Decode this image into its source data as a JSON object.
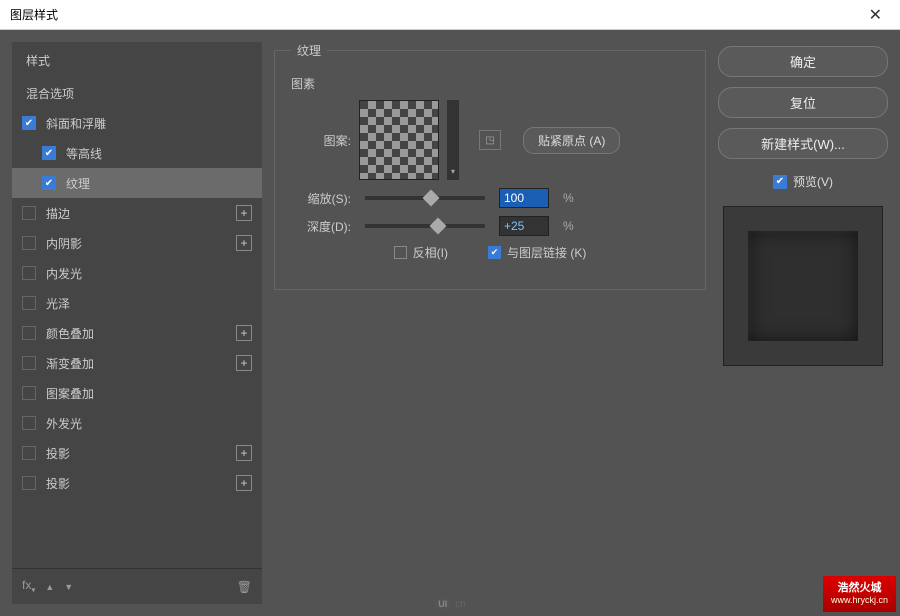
{
  "titlebar": {
    "title": "图层样式",
    "close": "✕"
  },
  "left": {
    "header_styles": "样式",
    "header_blend": "混合选项",
    "items": [
      {
        "label": "斜面和浮雕",
        "checked": true,
        "indent": false,
        "plus": false
      },
      {
        "label": "等高线",
        "checked": true,
        "indent": true,
        "plus": false
      },
      {
        "label": "纹理",
        "checked": true,
        "indent": true,
        "plus": false,
        "selected": true
      },
      {
        "label": "描边",
        "checked": false,
        "indent": false,
        "plus": true
      },
      {
        "label": "内阴影",
        "checked": false,
        "indent": false,
        "plus": true
      },
      {
        "label": "内发光",
        "checked": false,
        "indent": false,
        "plus": false
      },
      {
        "label": "光泽",
        "checked": false,
        "indent": false,
        "plus": false
      },
      {
        "label": "颜色叠加",
        "checked": false,
        "indent": false,
        "plus": true
      },
      {
        "label": "渐变叠加",
        "checked": false,
        "indent": false,
        "plus": true
      },
      {
        "label": "图案叠加",
        "checked": false,
        "indent": false,
        "plus": false
      },
      {
        "label": "外发光",
        "checked": false,
        "indent": false,
        "plus": false
      },
      {
        "label": "投影",
        "checked": false,
        "indent": false,
        "plus": true
      },
      {
        "label": "投影",
        "checked": false,
        "indent": false,
        "plus": true
      }
    ],
    "footer_fx": "fx",
    "footer_up": "▲",
    "footer_down": "▼",
    "footer_trash": "🗑"
  },
  "center": {
    "legend": "纹理",
    "elements_label": "图素",
    "pattern_label": "图案:",
    "snap_btn": "贴紧原点 (A)",
    "scale_label": "缩放(S):",
    "scale_value": "100",
    "scale_unit": "%",
    "depth_label": "深度(D):",
    "depth_value": "+25",
    "depth_unit": "%",
    "invert_label": "反相(I)",
    "link_label": "与图层链接 (K)"
  },
  "right": {
    "ok": "确定",
    "reset": "复位",
    "newstyle": "新建样式(W)...",
    "preview": "预览(V)"
  },
  "watermark": {
    "brand": "浩然火城",
    "url": "www.hryckj.cn"
  },
  "uicn": "cn"
}
